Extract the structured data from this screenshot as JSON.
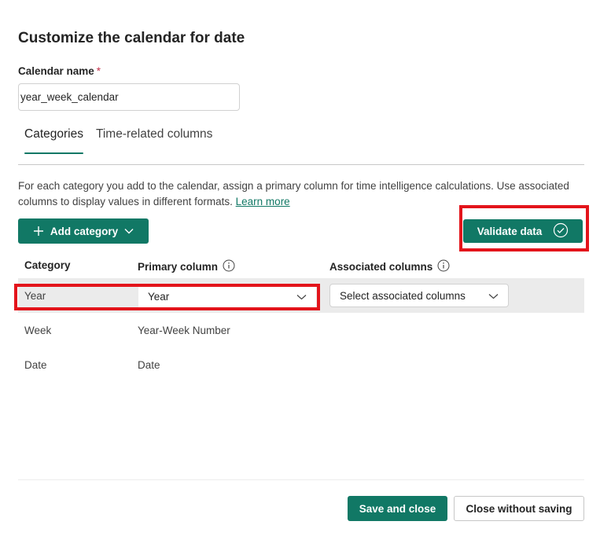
{
  "dialog": {
    "title": "Customize the calendar for date"
  },
  "calendar_name": {
    "label": "Calendar name",
    "required_marker": "*",
    "value": "year_week_calendar"
  },
  "tabs": [
    {
      "label": "Categories",
      "active": true
    },
    {
      "label": "Time-related columns",
      "active": false
    }
  ],
  "description": {
    "text": "For each category you add to the calendar, assign a primary column for time intelligence calculations. Use associated columns to display values in different formats.",
    "link": "Learn more"
  },
  "toolbar": {
    "add_category_label": "Add category",
    "validate_label": "Validate data"
  },
  "table": {
    "headers": {
      "category": "Category",
      "primary": "Primary column",
      "associated": "Associated columns"
    },
    "rows": [
      {
        "category": "Year",
        "primary": "Year",
        "associated_placeholder": "Select associated columns"
      },
      {
        "category": "Week",
        "primary": "Year-Week Number"
      },
      {
        "category": "Date",
        "primary": "Date"
      }
    ]
  },
  "footer": {
    "save_label": "Save and close",
    "close_label": "Close without saving"
  },
  "colors": {
    "accent": "#117865",
    "highlight": "#e3141b",
    "selected_row": "#ebebeb"
  },
  "icons": {
    "add": "plus-icon",
    "chevron": "chevron-down-icon",
    "validate": "checkmark-circle-icon",
    "info": "info-icon"
  }
}
